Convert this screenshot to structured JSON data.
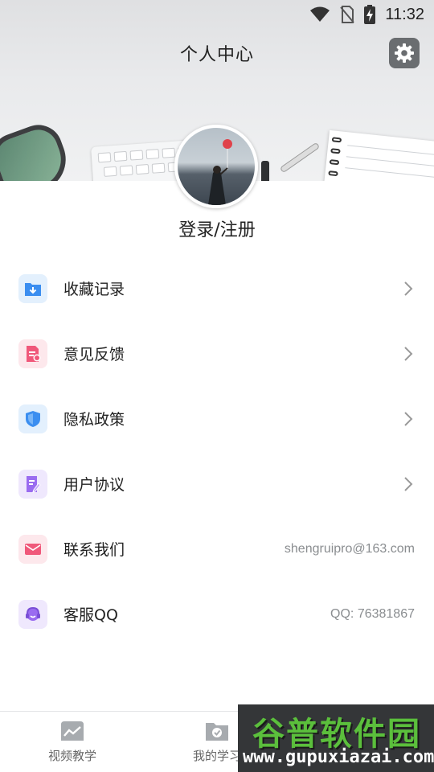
{
  "status_bar": {
    "time": "11:32",
    "icons": [
      "wifi-icon",
      "no-sim-icon",
      "battery-charging-icon"
    ]
  },
  "header": {
    "title": "个人中心",
    "settings_icon": "gear-icon"
  },
  "profile": {
    "login_label": "登录/注册"
  },
  "menu": {
    "items": [
      {
        "label": "收藏记录",
        "icon": "favorites-folder-icon",
        "color": "#3b8ef0"
      },
      {
        "label": "意见反馈",
        "icon": "feedback-document-icon",
        "color": "#f0587a"
      },
      {
        "label": "隐私政策",
        "icon": "shield-icon",
        "color": "#3b8ef0"
      },
      {
        "label": "用户协议",
        "icon": "agreement-document-icon",
        "color": "#9a6cf0"
      },
      {
        "label": "联系我们",
        "icon": "mail-icon",
        "color": "#f0587a",
        "value": "shengruipro@163.com"
      },
      {
        "label": "客服QQ",
        "icon": "headset-icon",
        "color": "#9a6cf0",
        "value": "QQ: 76381867"
      }
    ]
  },
  "bottom_nav": {
    "items": [
      {
        "label": "视频教学",
        "icon": "chart-icon"
      },
      {
        "label": "我的学习",
        "icon": "folder-check-icon"
      }
    ]
  },
  "watermark": {
    "title": "谷普软件园",
    "url": "www.gupuxiazai.com"
  }
}
